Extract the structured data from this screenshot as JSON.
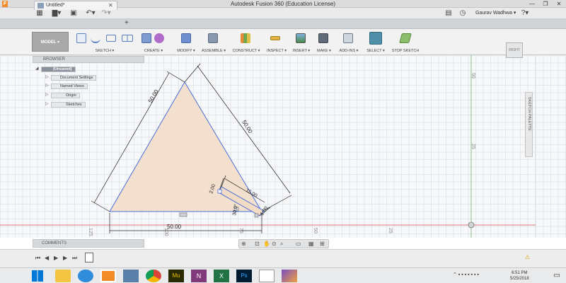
{
  "window": {
    "title": "Autodesk Fusion 360 (Education License)",
    "min_glyph": "—",
    "max_glyph": "❐",
    "close_glyph": "✕",
    "app_icon_letter": "F"
  },
  "quickbar": {
    "user_name": "Gaurav Wadhwa ▾"
  },
  "document_tab": {
    "name": "Untitled*",
    "close_glyph": "✕",
    "add_glyph": "+"
  },
  "toolbar": {
    "workspace_label": "MODEL ▾",
    "groups": [
      {
        "label": "SKETCH ▾"
      },
      {
        "label": "CREATE ▾"
      },
      {
        "label": "MODIFY ▾"
      },
      {
        "label": "ASSEMBLE ▾"
      },
      {
        "label": "CONSTRUCT ▾"
      },
      {
        "label": "INSPECT ▾"
      },
      {
        "label": "INSERT ▾"
      },
      {
        "label": "MAKE ▾"
      },
      {
        "label": "ADD-INS ▾"
      },
      {
        "label": "SELECT ▾"
      },
      {
        "label": "STOP SKETCH"
      }
    ]
  },
  "browser": {
    "title": "BROWSER",
    "items": [
      {
        "label": "(Unsaved)"
      },
      {
        "label": "Document Settings"
      },
      {
        "label": "Named Views"
      },
      {
        "label": "Origin"
      },
      {
        "label": "Sketches"
      }
    ]
  },
  "canvas": {
    "dimension_labels": {
      "left_side": "50.00",
      "right_side": "50.00",
      "bottom": "50.00",
      "small_width": "2.00",
      "small_length": "15.00",
      "small_end": "1.00",
      "angle": "30.0°"
    },
    "ruler_labels": {
      "v_50": "50",
      "v_25": "25",
      "h_125": "125",
      "h_100": "100",
      "h_75": "75",
      "h_50": "50",
      "h_25": "25"
    },
    "viewcube_label": "RIGHT",
    "sketch_palette_label": "SKETCH PALETTE"
  },
  "comments": {
    "title": "COMMENTS"
  },
  "colors": {
    "sketch_line": "#4a6fd6",
    "profile_fill": "#f3dcc6",
    "dimension": "#222222",
    "axis_red": "#d9534f",
    "axis_green": "#6cb06c"
  },
  "taskbar": {
    "time": "6:51 PM",
    "date": "5/25/2018"
  }
}
